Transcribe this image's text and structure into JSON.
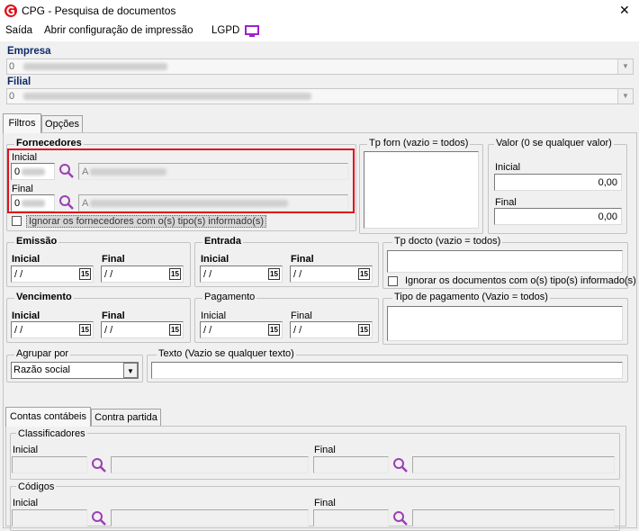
{
  "window": {
    "title": "CPG - Pesquisa de documentos",
    "close_symbol": "✕"
  },
  "menu": {
    "items": [
      "Saída",
      "Abrir configuração de impressão",
      "LGPD"
    ]
  },
  "empresa": {
    "label": "Empresa",
    "value": "0"
  },
  "filial": {
    "label": "Filial",
    "value": "0"
  },
  "tabs": [
    "Filtros",
    "Opções"
  ],
  "fornecedores": {
    "title": "Fornecedores",
    "inicial_label": "Inicial",
    "inicial_code": "0",
    "final_label": "Final",
    "final_code": "0",
    "inicial_name": "A",
    "final_name": "A",
    "ignore_label": "Ignorar os fornecedores com o(s) tipo(s) informado(s)"
  },
  "tp_forn": {
    "title": "Tp forn (vazio = todos)"
  },
  "valor": {
    "title": "Valor (0 se qualquer valor)",
    "inicial_label": "Inicial",
    "inicial_value": "0,00",
    "final_label": "Final",
    "final_value": "0,00"
  },
  "emissao": {
    "title": "Emissão",
    "inicial_label": "Inicial",
    "final_label": "Final",
    "inicial_value": " / /",
    "final_value": " / /"
  },
  "entrada": {
    "title": "Entrada",
    "inicial_label": "Inicial",
    "final_label": "Final",
    "inicial_value": " / /",
    "final_value": " / /"
  },
  "tp_docto": {
    "title": "Tp docto (vazio = todos)",
    "ignore_label": "Ignorar os documentos com o(s) tipo(s) informado(s)"
  },
  "vencimento": {
    "title": "Vencimento",
    "inicial_label": "Inicial",
    "final_label": "Final",
    "inicial_value": " / /",
    "final_value": " / /"
  },
  "pagamento": {
    "title": "Pagamento",
    "inicial_label": "Inicial",
    "final_label": "Final",
    "inicial_value": " / /",
    "final_value": " / /"
  },
  "tipo_pagamento": {
    "title": "Tipo de pagamento (Vazio = todos)"
  },
  "agrupar": {
    "title": "Agrupar por",
    "value": "Razão social"
  },
  "texto": {
    "title": "Texto (Vazio se qualquer texto)"
  },
  "subtabs": [
    "Contas contábeis",
    "Contra partida"
  ],
  "classificadores": {
    "title": "Classificadores",
    "inicial_label": "Inicial",
    "final_label": "Final"
  },
  "codigos": {
    "title": "Códigos",
    "inicial_label": "Inicial",
    "final_label": "Final"
  },
  "cal_icon": "15",
  "colors": {
    "accent": "#e0121a",
    "navy": "#0b2a6b",
    "magnifier": "#9b3fb5",
    "lgpd": "#a020d0"
  },
  "icons": [
    "app-logo-icon",
    "close-icon",
    "lgpd-monitor-icon",
    "magnifier-icon",
    "calendar-icon",
    "dropdown-arrow-icon",
    "checkbox-icon"
  ]
}
